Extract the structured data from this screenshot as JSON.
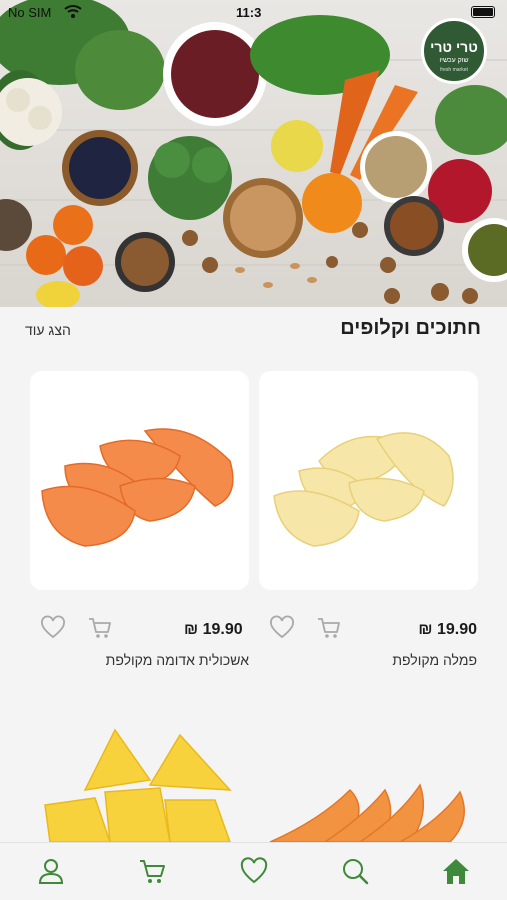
{
  "status_bar": {
    "carrier": "No SIM",
    "time": "11:3"
  },
  "logo": {
    "line1": "טרי טרי",
    "line2": "שוק עכשיו",
    "line3": "fresh market"
  },
  "section": {
    "title": "חתוכים וקלופים",
    "show_more": "הצג עוד"
  },
  "products": [
    {
      "name": "פמלה מקולפת",
      "price": "₪ 19.90",
      "image": "peeled-pomelo"
    },
    {
      "name": "אשכולית אדומה מקולפת",
      "price": "₪ 19.90",
      "image": "peeled-red-grapefruit"
    }
  ],
  "next_row_images": [
    "pineapple-chunks",
    "papaya-slices"
  ],
  "icons": {
    "wishlist": "heart-icon",
    "cart": "cart-icon",
    "tabs": [
      "user-icon",
      "cart-icon",
      "heart-icon",
      "search-icon",
      "home-icon"
    ]
  },
  "colors": {
    "accent": "#3f8a3a",
    "card": "#ffffff",
    "background": "#f4f4f4",
    "icon_gray": "#a9a9a9"
  }
}
